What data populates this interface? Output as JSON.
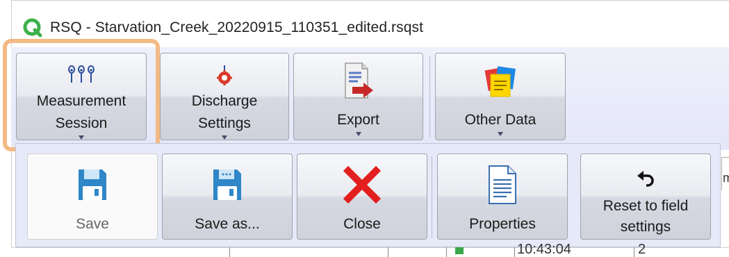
{
  "window": {
    "title": "RSQ - Starvation_Creek_20220915_110351_edited.rsqst",
    "logo_icon": "app-q-logo-icon"
  },
  "ribbon": {
    "buttons": [
      {
        "line1": "Measurement",
        "line2": "Session",
        "icon": "measurement-pins-icon",
        "highlighted": true
      },
      {
        "line1": "Discharge",
        "line2": "Settings",
        "icon": "discharge-gear-icon"
      },
      {
        "label": "Export",
        "icon": "export-document-arrow-icon"
      },
      {
        "label": "Other Data",
        "icon": "sticky-notes-icon"
      }
    ]
  },
  "submenu": {
    "items": [
      {
        "label": "Save",
        "icon": "floppy-disk-icon",
        "enabled": false
      },
      {
        "label": "Save as...",
        "icon": "floppy-disk-dots-icon",
        "enabled": true
      },
      {
        "label": "Close",
        "icon": "red-x-icon",
        "enabled": true
      },
      {
        "label": "Properties",
        "icon": "document-icon",
        "enabled": true
      },
      {
        "line1": "Reset to field",
        "line2": "settings",
        "icon": "undo-arrow-icon",
        "enabled": true
      }
    ]
  },
  "background": {
    "time_value": "10:43:04",
    "count_value": "2",
    "right_edge_text": "m"
  },
  "colors": {
    "highlight": "#f3ba86",
    "ribbon_bg": "#e4e7f8",
    "close_red": "#e21e1e",
    "floppy_blue": "#2f86c8",
    "logo_green": "#3db04a"
  }
}
